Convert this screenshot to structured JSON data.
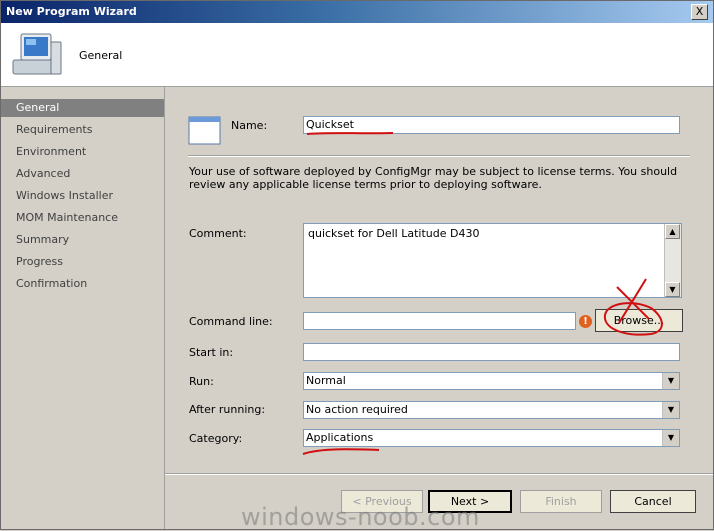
{
  "window": {
    "title": "New Program Wizard",
    "close_glyph": "X"
  },
  "header": {
    "title": "General",
    "icon": "computer-icon"
  },
  "nav": {
    "items": [
      {
        "label": "General",
        "selected": true
      },
      {
        "label": "Requirements",
        "selected": false
      },
      {
        "label": "Environment",
        "selected": false
      },
      {
        "label": "Advanced",
        "selected": false
      },
      {
        "label": "Windows Installer",
        "selected": false
      },
      {
        "label": "MOM Maintenance",
        "selected": false
      },
      {
        "label": "Summary",
        "selected": false
      },
      {
        "label": "Progress",
        "selected": false
      },
      {
        "label": "Confirmation",
        "selected": false
      }
    ]
  },
  "form": {
    "name_label": "Name:",
    "name_value": "Quickset",
    "license_text": "Your use of software deployed by ConfigMgr may be subject to license terms. You should review any applicable license terms prior to deploying software.",
    "comment_label": "Comment:",
    "comment_value": "quickset for Dell Latitude D430",
    "command_label": "Command line:",
    "command_value": "",
    "browse_label": "Browse...",
    "startin_label": "Start in:",
    "startin_value": "",
    "run_label": "Run:",
    "run_value": "Normal",
    "after_label": "After running:",
    "after_value": "No action required",
    "category_label": "Category:",
    "category_value": "Applications"
  },
  "buttons": {
    "previous": "< Previous",
    "next": "Next >",
    "finish": "Finish",
    "cancel": "Cancel"
  },
  "watermark": "windows-noob.com",
  "colors": {
    "annotation_red": "#d01010",
    "nav_selected": "#808080",
    "title_gradient_start": "#0a246a"
  }
}
